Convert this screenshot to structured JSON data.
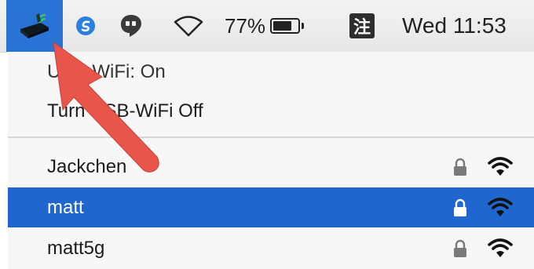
{
  "menubar": {
    "battery": {
      "percent_text": "77%",
      "level": 0.77
    },
    "input_method": {
      "label": "注"
    },
    "clock": "Wed 11:53",
    "icons": {
      "usb_wifi": "usb-wifi-adapter-icon",
      "app1": "simplenote-icon",
      "app2": "hangouts-icon",
      "wifi": "wifi-icon",
      "battery": "battery-icon"
    }
  },
  "dropdown": {
    "status": "USB-WiFi: On",
    "toggle": "Turn USB-WiFi Off",
    "networks": [
      {
        "name": "Jackchen",
        "secured": true,
        "selected": false
      },
      {
        "name": "matt",
        "secured": true,
        "selected": true
      },
      {
        "name": "matt5g",
        "secured": true,
        "selected": false
      }
    ]
  },
  "colors": {
    "selection": "#1f66cf",
    "annotation_arrow": "#e8554a",
    "menubar_highlight": "#2a73d6"
  }
}
